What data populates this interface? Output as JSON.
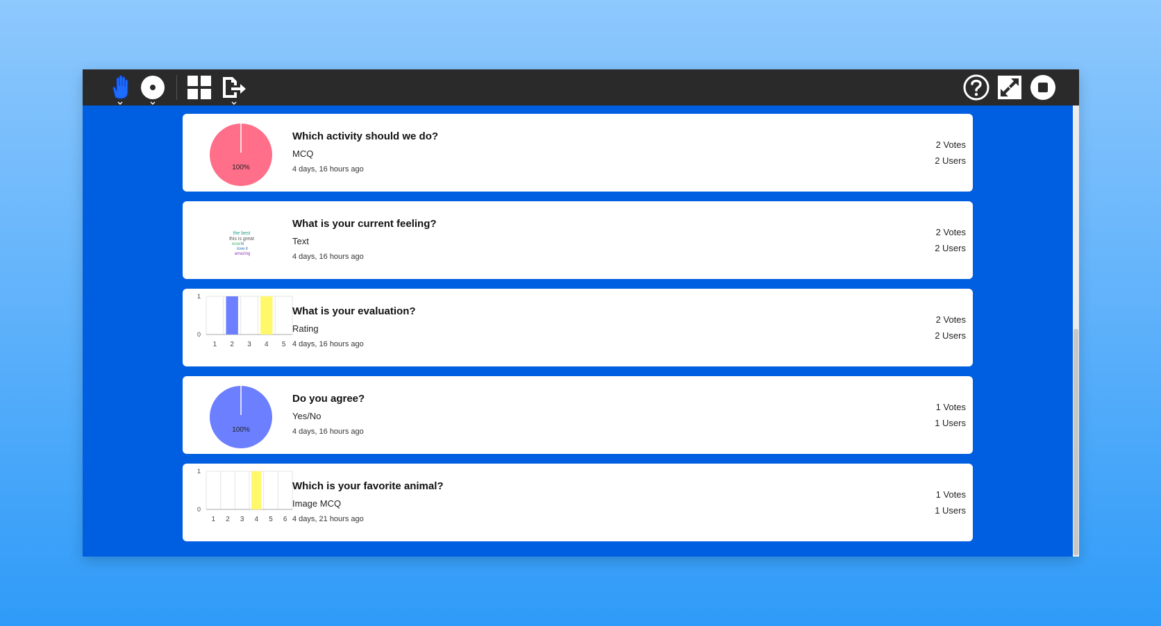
{
  "toolbar": {
    "left_icons": [
      "hand-raise-icon",
      "record-icon",
      "grid-icon",
      "export-icon"
    ],
    "right_icons": [
      "help-icon",
      "fullscreen-icon",
      "stop-icon"
    ]
  },
  "colors": {
    "toolbar_bg": "#2a2a2a",
    "content_bg": "#005ee0",
    "pie_pink": "#ff6f8a",
    "pie_blue": "#6b7fff",
    "bar_blue": "#6b7fff",
    "bar_yellow": "#fff86a"
  },
  "polls": [
    {
      "title": "Which activity should we do?",
      "type": "MCQ",
      "time": "4 days, 16 hours ago",
      "votes": "2 Votes",
      "users": "2 Users",
      "chart": {
        "type": "pie",
        "label": "100%",
        "values": [
          100
        ]
      }
    },
    {
      "title": "What is your current feeling?",
      "type": "Text",
      "time": "4 days, 16 hours ago",
      "votes": "2 Votes",
      "users": "2 Users",
      "wordcloud": [
        "the best",
        "this is great",
        "wow",
        "hi",
        "love it",
        "amazing"
      ]
    },
    {
      "title": "What is your evaluation?",
      "type": "Rating",
      "time": "4 days, 16 hours ago",
      "votes": "2 Votes",
      "users": "2 Users",
      "chart": {
        "type": "bar",
        "categories": [
          "1",
          "2",
          "3",
          "4",
          "5"
        ],
        "values": [
          0,
          1,
          0,
          1,
          0
        ],
        "ylim": [
          0,
          1
        ],
        "y_ticks": [
          "0",
          "1"
        ]
      }
    },
    {
      "title": "Do you agree?",
      "type": "Yes/No",
      "time": "4 days, 16 hours ago",
      "votes": "1 Votes",
      "users": "1 Users",
      "chart": {
        "type": "pie",
        "label": "100%",
        "values": [
          100
        ]
      }
    },
    {
      "title": "Which is your favorite animal?",
      "type": "Image MCQ",
      "time": "4 days, 21 hours ago",
      "votes": "1 Votes",
      "users": "1 Users",
      "chart": {
        "type": "bar",
        "categories": [
          "1",
          "2",
          "3",
          "4",
          "5",
          "6"
        ],
        "values": [
          0,
          0,
          0,
          1,
          0,
          0
        ],
        "ylim": [
          0,
          1
        ],
        "y_ticks": [
          "0",
          "1"
        ]
      }
    }
  ],
  "chart_data": [
    {
      "type": "pie",
      "values": [
        100
      ],
      "labels": [
        "100%"
      ]
    },
    {
      "type": "bar",
      "categories": [
        "1",
        "2",
        "3",
        "4",
        "5"
      ],
      "values": [
        0,
        1,
        0,
        1,
        0
      ],
      "ylim": [
        0,
        1
      ]
    },
    {
      "type": "pie",
      "values": [
        100
      ],
      "labels": [
        "100%"
      ]
    },
    {
      "type": "bar",
      "categories": [
        "1",
        "2",
        "3",
        "4",
        "5",
        "6"
      ],
      "values": [
        0,
        0,
        0,
        1,
        0,
        0
      ],
      "ylim": [
        0,
        1
      ]
    }
  ]
}
